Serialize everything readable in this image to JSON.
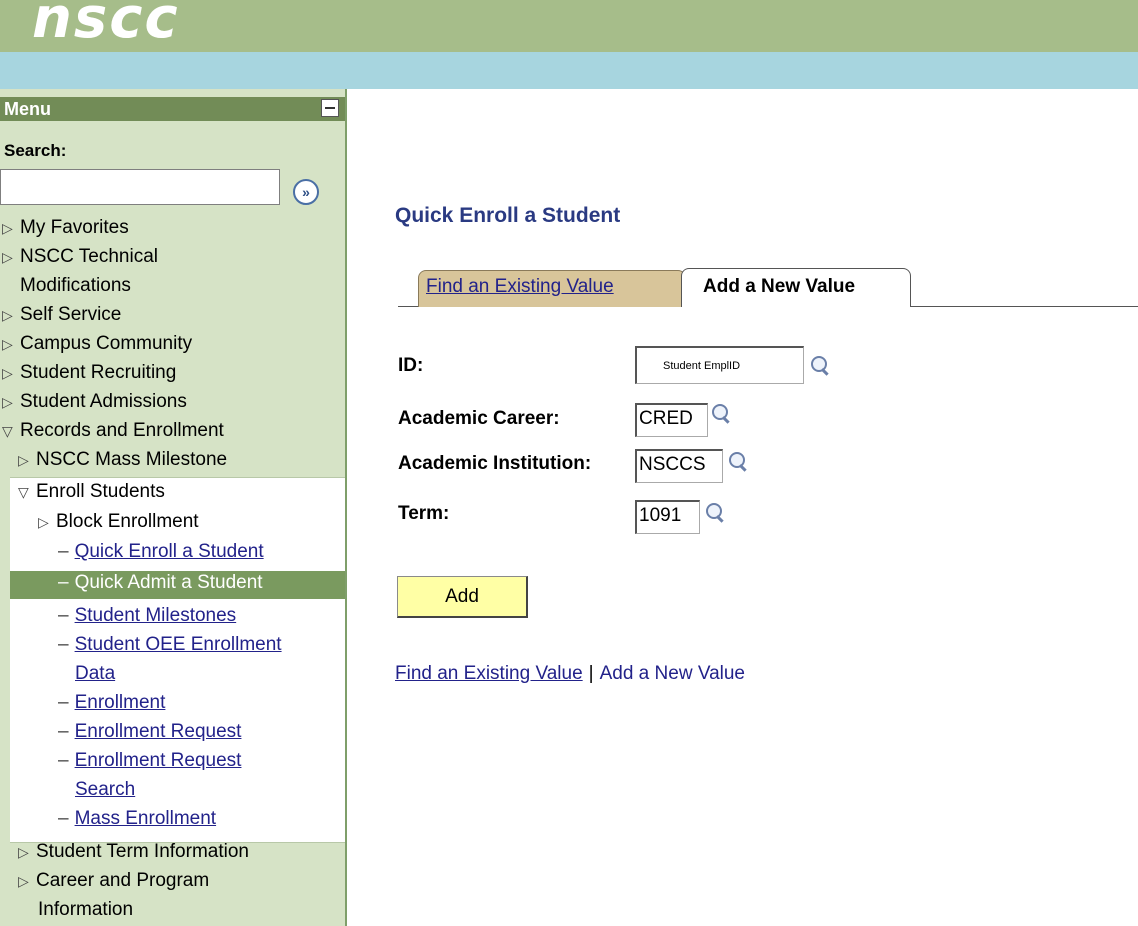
{
  "header": {
    "logo": "nscc"
  },
  "menu": {
    "title": "Menu",
    "search_label": "Search:",
    "search_value": "",
    "items": [
      {
        "label": "My Favorites"
      },
      {
        "label": "NSCC Technical"
      },
      {
        "label": "Modifications"
      },
      {
        "label": "Self Service"
      },
      {
        "label": "Campus Community"
      },
      {
        "label": "Student Recruiting"
      },
      {
        "label": "Student Admissions"
      },
      {
        "label": "Records and Enrollment"
      },
      {
        "label": "NSCC Mass Milestone"
      },
      {
        "label": "Enroll Students"
      },
      {
        "label": "Block Enrollment"
      },
      {
        "label": "Quick Enroll a Student"
      },
      {
        "label": "Quick Admit a Student"
      },
      {
        "label": "Student Milestones"
      },
      {
        "label": "Student OEE Enrollment"
      },
      {
        "label": "Data"
      },
      {
        "label": "Enrollment"
      },
      {
        "label": "Enrollment Request"
      },
      {
        "label": "Enrollment Request"
      },
      {
        "label": "Search"
      },
      {
        "label": "Mass Enrollment"
      },
      {
        "label": "Student Term Information"
      },
      {
        "label": "Career and Program"
      },
      {
        "label": "Information"
      }
    ]
  },
  "page": {
    "title": "Quick Enroll a Student",
    "tabs": [
      {
        "label": "Find an Existing Value"
      },
      {
        "label": "Add a New Value"
      }
    ],
    "fields": {
      "id_label": "ID:",
      "id_placeholder": "Student EmplID",
      "career_label": "Academic Career:",
      "career_value": "CRED",
      "institution_label": "Academic Institution:",
      "institution_value": "NSCCS",
      "term_label": "Term:",
      "term_value": "1091"
    },
    "add_button": "Add",
    "bottom_links": {
      "find": "Find an Existing Value",
      "separator": "|",
      "add": "Add a New Value"
    }
  },
  "colors": {
    "banner": "#a6bd8a",
    "subbar": "#a7d5df",
    "sidebar": "#d6e3c6",
    "menu_header": "#728c57",
    "title": "#2a3a82",
    "link": "#22228a",
    "add_button": "#ffffa5"
  }
}
